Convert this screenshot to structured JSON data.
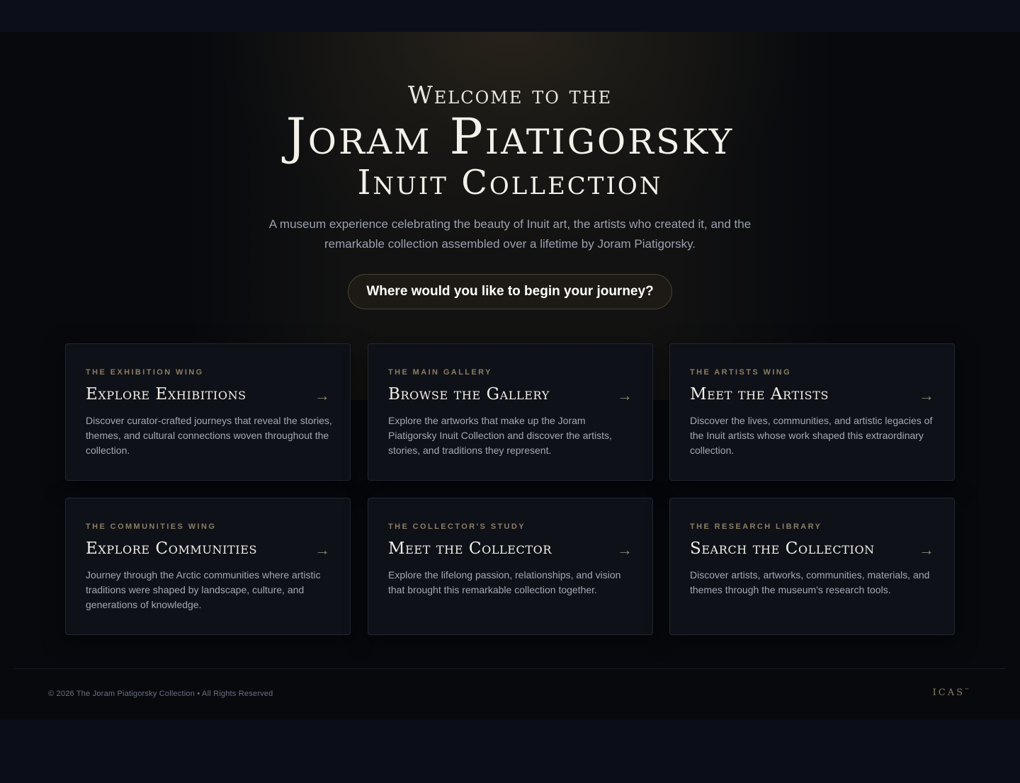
{
  "hero": {
    "welcome": "Welcome to the",
    "title_main": "Joram Piatigorsky",
    "title_sub": "Inuit Collection",
    "intro": "A museum experience celebrating the beauty of Inuit art, the artists who created it, and the remarkable collection assembled over a lifetime by Joram Piatigorsky.",
    "journey_prompt": "Where would you like to begin your journey?"
  },
  "cards": [
    {
      "eyebrow": "The Exhibition Wing",
      "title": "Explore Exhibitions",
      "arrow": "→",
      "desc": "Discover curator-crafted journeys that reveal the stories, themes, and cultural connections woven throughout the collection."
    },
    {
      "eyebrow": "The Main Gallery",
      "title": "Browse the Gallery",
      "arrow": "→",
      "desc": "Explore the artworks that make up the Joram Piatigorsky Inuit Collection and discover the artists, stories, and traditions they represent."
    },
    {
      "eyebrow": "The Artists Wing",
      "title": "Meet the Artists",
      "arrow": "→",
      "desc": "Discover the lives, communities, and artistic legacies of the Inuit artists whose work shaped this extraordinary collection."
    },
    {
      "eyebrow": "The Communities Wing",
      "title": "Explore Communities",
      "arrow": "→",
      "desc": "Journey through the Arctic communities where artistic traditions were shaped by landscape, culture, and generations of knowledge."
    },
    {
      "eyebrow": "The Collector's Study",
      "title": "Meet the Collector",
      "arrow": "→",
      "desc": "Explore the lifelong passion, relationships, and vision that brought this remarkable collection together."
    },
    {
      "eyebrow": "The Research Library",
      "title": "Search the Collection",
      "arrow": "→",
      "desc": "Discover artists, artworks, communities, materials, and themes through the museum's research tools."
    }
  ],
  "footer": {
    "copyright": "© 2026 The Joram Piatigorsky Collection • All Rights Reserved",
    "brand": "ICAS",
    "brand_mark": "™"
  },
  "colors": {
    "accent_gold": "#8b7d62",
    "background": "#07090d",
    "card_background": "#0e1118"
  }
}
